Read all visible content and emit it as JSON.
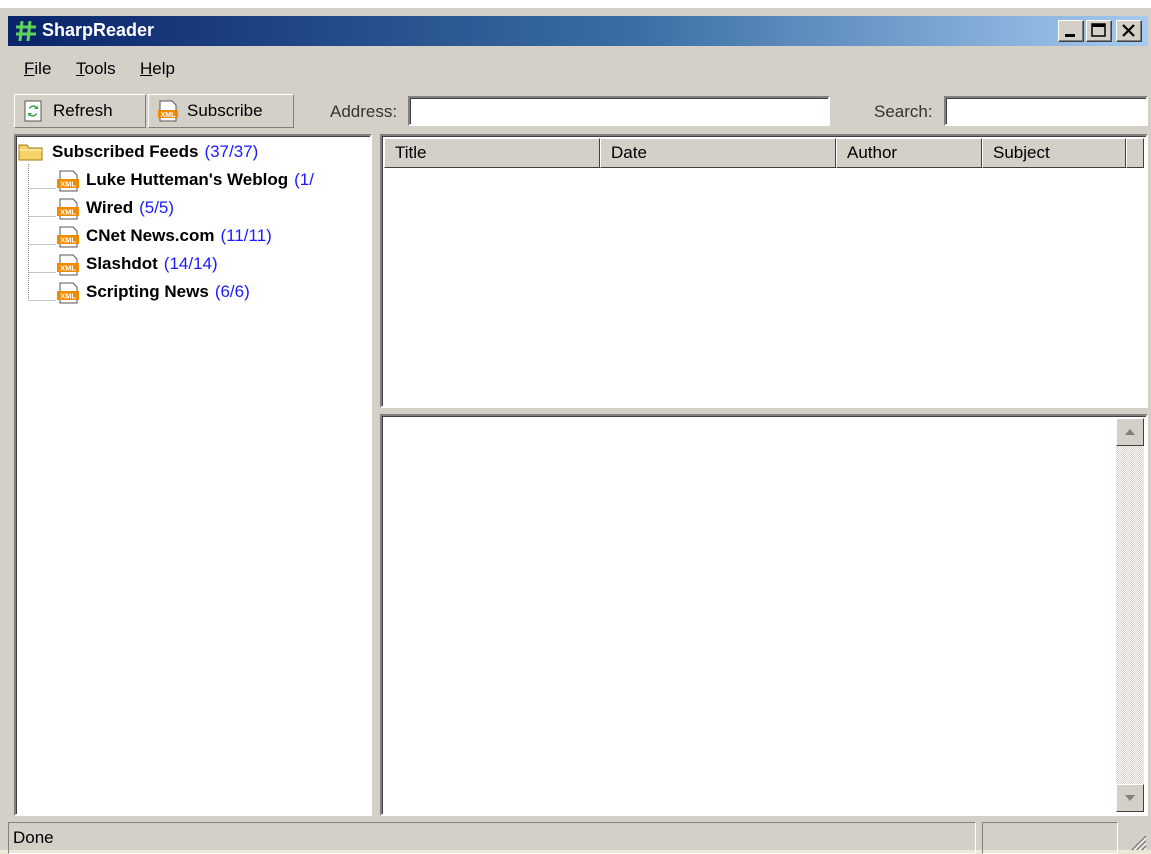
{
  "window": {
    "title": "SharpReader"
  },
  "menu": [
    "File",
    "Tools",
    "Help"
  ],
  "menu_underline": [
    "F",
    "T",
    "H"
  ],
  "toolbar": {
    "refresh_label": "Refresh",
    "subscribe_label": "Subscribe",
    "address_label": "Address:",
    "address_value": "",
    "search_label": "Search:",
    "search_value": ""
  },
  "feeds": {
    "root": {
      "name": "Subscribed Feeds",
      "count": "(37/37)"
    },
    "items": [
      {
        "name": "Luke Hutteman's Weblog",
        "count": "(1/"
      },
      {
        "name": "Wired",
        "count": "(5/5)"
      },
      {
        "name": "CNet News.com",
        "count": "(11/11)"
      },
      {
        "name": "Slashdot",
        "count": "(14/14)"
      },
      {
        "name": "Scripting News",
        "count": "(6/6)"
      }
    ]
  },
  "columns": [
    "Title",
    "Date",
    "Author",
    "Subject"
  ],
  "status": {
    "text": "Done"
  },
  "icons": {
    "app": "sharp-hash-icon",
    "refresh": "refresh-icon",
    "subscribe": "xml-feed-icon",
    "folder": "folder-icon",
    "feed": "xml-feed-icon"
  },
  "colors": {
    "count_text": "#1a1aff",
    "title_bar_start": "#0a246a",
    "title_bar_end": "#a6caf0"
  }
}
